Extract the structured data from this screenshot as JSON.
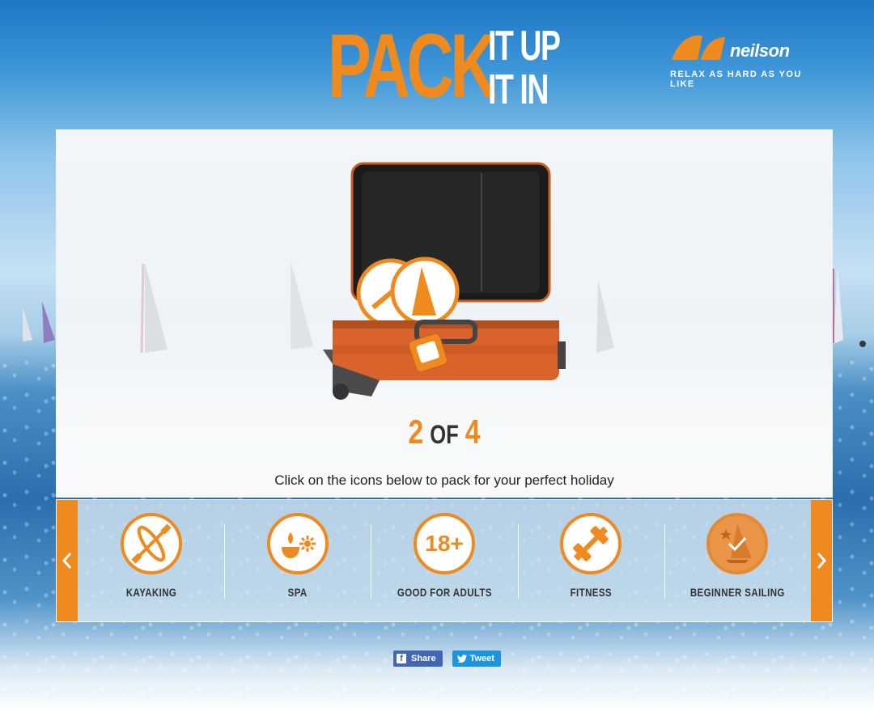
{
  "header": {
    "title_main": "PACK",
    "title_line1": "IT UP",
    "title_line2": "IT IN",
    "brand_name": "neilson",
    "brand_tagline": "RELAX AS HARD AS YOU LIKE"
  },
  "progress": {
    "current": "2",
    "of_label": "OF",
    "total": "4"
  },
  "instruction": "Click on the icons below to pack for your perfect holiday",
  "carousel": {
    "items": [
      {
        "label": "KAYAKING",
        "icon": "kayak-icon",
        "selected": false
      },
      {
        "label": "SPA",
        "icon": "spa-icon",
        "selected": false
      },
      {
        "label": "GOOD FOR ADULTS",
        "icon": "adults-18-icon",
        "badge_text": "18+",
        "selected": false
      },
      {
        "label": "FITNESS",
        "icon": "dumbbell-icon",
        "selected": false
      },
      {
        "label": "BEGINNER SAILING",
        "icon": "sailing-icon",
        "selected": true
      }
    ]
  },
  "social": {
    "share_label": "Share",
    "tweet_label": "Tweet"
  },
  "colors": {
    "accent": "#ef8a1e",
    "facebook": "#4267b2",
    "twitter": "#1b95e0"
  }
}
